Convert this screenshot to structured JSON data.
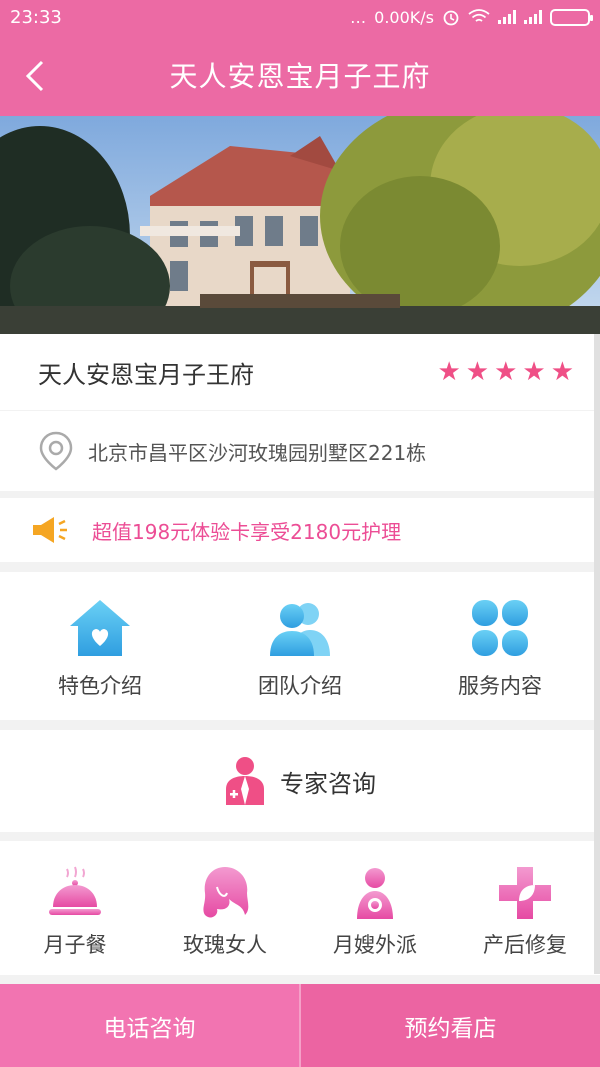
{
  "status": {
    "time": "23:33",
    "dots": "…",
    "speed": "0.00K/s",
    "alarm_icon": "alarm-icon",
    "wifi_icon": "wifi-icon",
    "signal_icon": "signal-icon",
    "battery_icon": "battery-icon"
  },
  "header": {
    "title": "天人安恩宝月子王府",
    "back_icon": "chevron-left-icon"
  },
  "hero": {
    "description_icon": "villa-photo"
  },
  "store": {
    "name": "天人安恩宝月子王府",
    "rating": 5,
    "stars": [
      "★",
      "★",
      "★",
      "★",
      "★"
    ],
    "address": "北京市昌平区沙河玫瑰园别墅区221栋"
  },
  "promo": {
    "text": "超值198元体验卡享受2180元护理",
    "icon": "megaphone-icon"
  },
  "services": [
    {
      "label": "特色介绍",
      "icon": "house-heart-icon"
    },
    {
      "label": "团队介绍",
      "icon": "team-icon"
    },
    {
      "label": "服务内容",
      "icon": "grid-clover-icon"
    }
  ],
  "expert": {
    "label": "专家咨询",
    "icon": "doctor-icon"
  },
  "features": [
    {
      "label": "月子餐",
      "icon": "meal-cloche-icon"
    },
    {
      "label": "玫瑰女人",
      "icon": "woman-hair-icon"
    },
    {
      "label": "月嫂外派",
      "icon": "nanny-baby-icon"
    },
    {
      "label": "产后修复",
      "icon": "medical-cross-leaf-icon"
    }
  ],
  "bottom": {
    "call_label": "电话咨询",
    "book_label": "预约看店"
  },
  "colors": {
    "brand": "#ec6aa4",
    "accent": "#ef4f86",
    "icon_blue": "#3fb0e9"
  }
}
